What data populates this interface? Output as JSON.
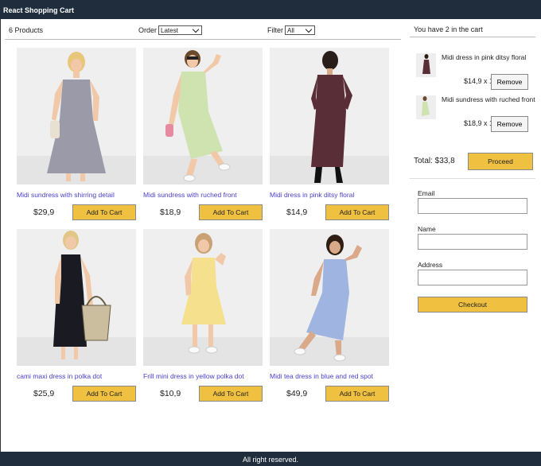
{
  "header": {
    "title": "React Shopping Cart"
  },
  "filterbar": {
    "count_label": "6 Products",
    "order_label": "Order",
    "order_value": "Latest",
    "filter_label": "Filter",
    "filter_value": "All"
  },
  "products": [
    {
      "title": "Midi sundress with shirring detail",
      "price": "$29,9",
      "button": "Add To Cart"
    },
    {
      "title": "Midi sundress with ruched front",
      "price": "$18,9",
      "button": "Add To Cart"
    },
    {
      "title": "Midi dress in pink ditsy floral",
      "price": "$14,9",
      "button": "Add To Cart"
    },
    {
      "title": "cami maxi dress in polka dot",
      "price": "$25,9",
      "button": "Add To Cart"
    },
    {
      "title": "Frill mini dress in yellow polka dot",
      "price": "$10,9",
      "button": "Add To Cart"
    },
    {
      "title": "Midi tea dress in blue and red spot",
      "price": "$49,9",
      "button": "Add To Cart"
    }
  ],
  "cart": {
    "header": "You have 2 in the cart",
    "items": [
      {
        "name": "Midi dress in pink ditsy floral",
        "qty": "$14,9 x 1",
        "remove": "Remove"
      },
      {
        "name": "Midi sundress with ruched front",
        "qty": "$18,9 x 1",
        "remove": "Remove"
      }
    ],
    "total": "Total: $33,8",
    "proceed": "Proceed"
  },
  "form": {
    "email_label": "Email",
    "name_label": "Name",
    "address_label": "Address",
    "checkout": "Checkout"
  },
  "footer": {
    "text": "All right reserved."
  },
  "colors": {
    "header_bg": "#1f2d3d",
    "button_bg": "#f0c040",
    "link": "#4b3ec7"
  }
}
